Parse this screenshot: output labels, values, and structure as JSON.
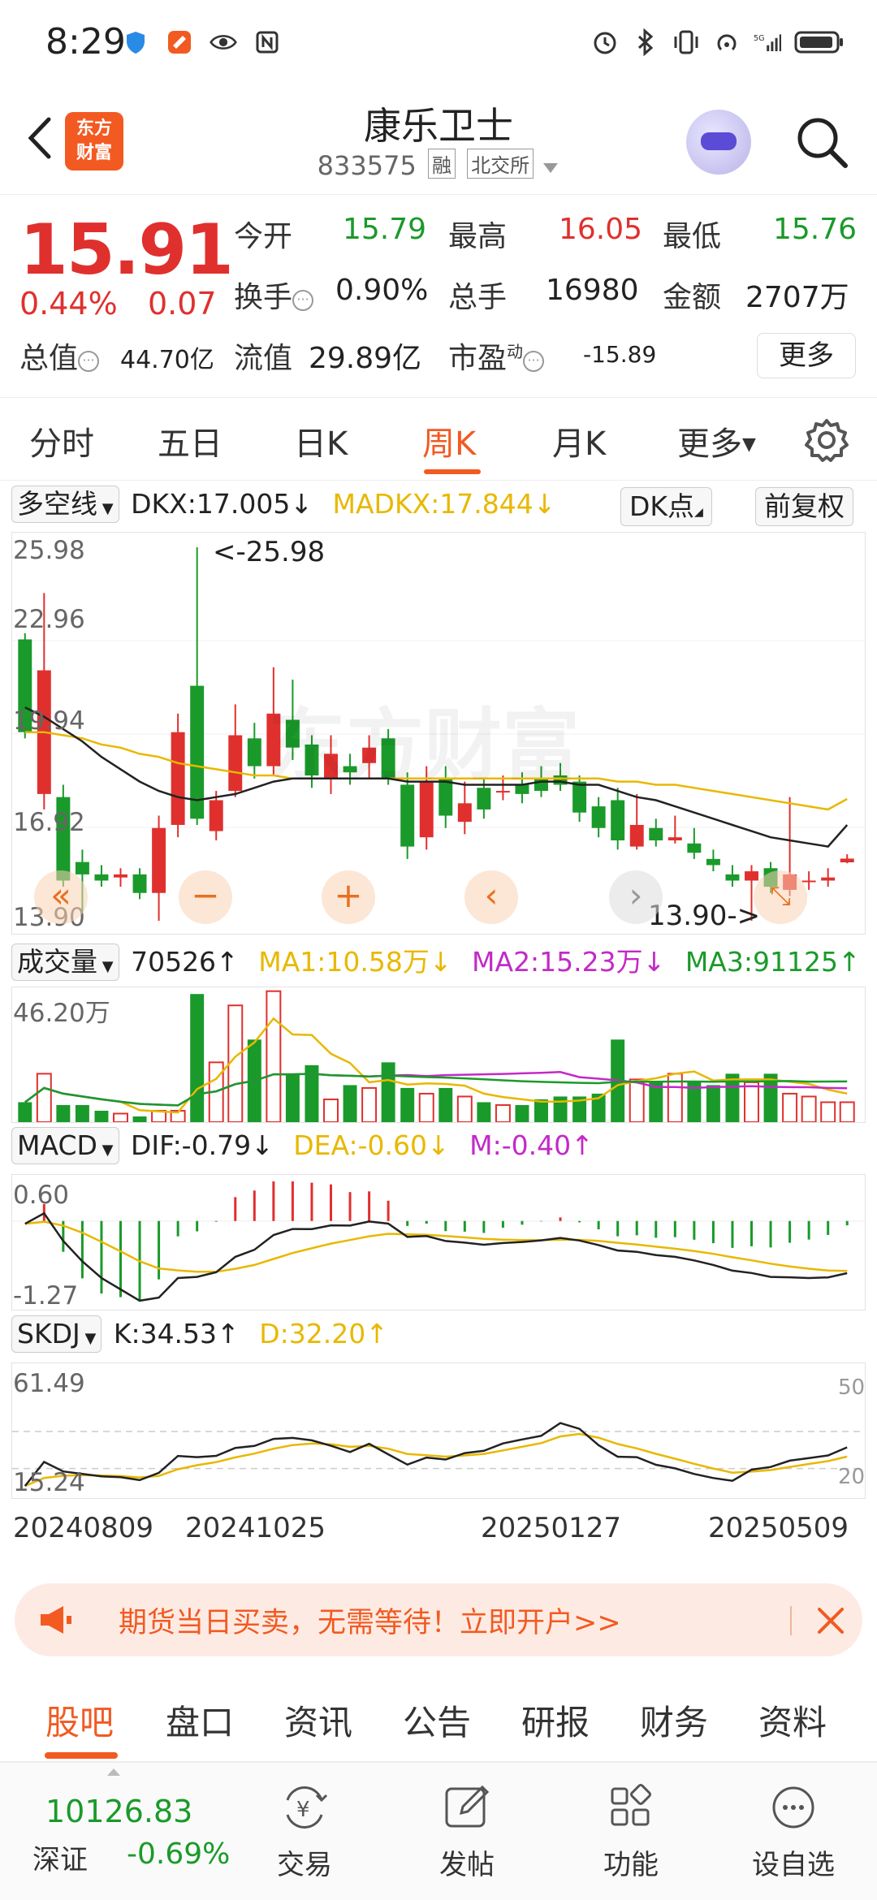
{
  "status_bar": {
    "time": "8:29",
    "left_icons": [
      "shield-icon",
      "message-app-icon",
      "eye-icon",
      "nfc-icon"
    ],
    "right_icons": [
      "alarm-icon",
      "bluetooth-icon",
      "vibrate-icon",
      "hotspot-icon",
      "signal-5g-icon",
      "battery-icon"
    ]
  },
  "header": {
    "logo_line1": "东方",
    "logo_line2": "财富",
    "title": "康乐卫士",
    "code": "833575",
    "tag1": "融",
    "tag2": "北交所"
  },
  "quote": {
    "price": "15.91",
    "change_pct": "0.44%",
    "change_amt": "0.07",
    "open_label": "今开",
    "open": "15.79",
    "high_label": "最高",
    "high": "16.05",
    "low_label": "最低",
    "low": "15.76",
    "turnover_label": "换手",
    "turnover": "0.90%",
    "volume_label": "总手",
    "volume": "16980",
    "amount_label": "金额",
    "amount": "2707万",
    "total_cap_label": "总值",
    "total_cap": "44.70亿",
    "float_cap_label": "流值",
    "float_cap": "29.89亿",
    "pe_label": "市盈",
    "pe_sup": "动",
    "pe": "-15.89",
    "more_label": "更多"
  },
  "period_tabs": {
    "items": [
      "分时",
      "五日",
      "日K",
      "周K",
      "月K",
      "更多"
    ],
    "active": "周K"
  },
  "main_chart": {
    "indicator_select": "多空线",
    "dkx": "DKX:17.005↓",
    "madkx": "MADKX:17.844↓",
    "dk_chip": "DK点",
    "adjust_chip": "前复权",
    "y_labels": [
      "25.98",
      "22.96",
      "19.94",
      "16.92",
      "13.90"
    ],
    "max_annotation": "<-25.98",
    "min_annotation": "13.90->",
    "watermark": "东方财富"
  },
  "volume_chart": {
    "indicator_select": "成交量",
    "vol": "70526↑",
    "ma1": "MA1:10.58万↓",
    "ma2": "MA2:15.23万↓",
    "ma3": "MA3:91125↑",
    "y_label": "46.20万"
  },
  "macd_chart": {
    "indicator_select": "MACD",
    "dif": "DIF:-0.79↓",
    "dea": "DEA:-0.60↓",
    "m": "M:-0.40↑",
    "y_top": "0.60",
    "y_bottom": "-1.27"
  },
  "skdj_chart": {
    "indicator_select": "SKDJ",
    "k": "K:34.53↑",
    "d": "D:32.20↑",
    "y_top": "61.49",
    "y_bottom": "15.24",
    "right_top": "50",
    "right_bottom": "20"
  },
  "dates": [
    "20240809",
    "20241025",
    "20250127",
    "20250509"
  ],
  "colors": {
    "up": "#e0302e",
    "down": "#1a9a2a",
    "accent": "#f25a22",
    "ma_yellow": "#e8b800",
    "ma_magenta": "#c22ac8"
  },
  "banner": {
    "text": "期货当日买卖，无需等待！立即开户>>"
  },
  "bottom_tabs": {
    "items": [
      "股吧",
      "盘口",
      "资讯",
      "公告",
      "研报",
      "财务",
      "资料"
    ],
    "active": "股吧"
  },
  "bottom_nav": {
    "index_value": "10126.83",
    "index_name": "深证",
    "index_pct": "-0.69%",
    "items": [
      "交易",
      "发帖",
      "功能",
      "设自选"
    ]
  },
  "chart_data": {
    "type": "candlestick",
    "period": "weekly",
    "x_tick_labels": [
      "20240809",
      "20241025",
      "20250127",
      "20250509"
    ],
    "price_axis": [
      13.9,
      25.98
    ],
    "price_range_marked": {
      "high": 25.98,
      "low": 13.9
    },
    "candles": [
      {
        "o": 23.0,
        "c": 20.0,
        "h": 23.2,
        "l": 19.8
      },
      {
        "o": 18.0,
        "c": 22.0,
        "h": 24.5,
        "l": 17.5
      },
      {
        "o": 17.9,
        "c": 15.2,
        "h": 18.3,
        "l": 15.0
      },
      {
        "o": 15.8,
        "c": 15.4,
        "h": 16.2,
        "l": 14.2
      },
      {
        "o": 15.4,
        "c": 15.2,
        "h": 15.7,
        "l": 15.0
      },
      {
        "o": 15.3,
        "c": 15.4,
        "h": 15.6,
        "l": 15.0
      },
      {
        "o": 15.4,
        "c": 14.8,
        "h": 15.6,
        "l": 14.6
      },
      {
        "o": 14.8,
        "c": 16.9,
        "h": 17.3,
        "l": 13.9
      },
      {
        "o": 17.0,
        "c": 20.0,
        "h": 20.6,
        "l": 16.6
      },
      {
        "o": 21.5,
        "c": 17.2,
        "h": 25.98,
        "l": 17.0
      },
      {
        "o": 16.8,
        "c": 17.8,
        "h": 18.1,
        "l": 16.5
      },
      {
        "o": 18.1,
        "c": 19.9,
        "h": 20.9,
        "l": 17.9
      },
      {
        "o": 19.8,
        "c": 18.9,
        "h": 20.3,
        "l": 18.5
      },
      {
        "o": 18.9,
        "c": 20.6,
        "h": 22.1,
        "l": 18.6
      },
      {
        "o": 20.4,
        "c": 19.5,
        "h": 21.7,
        "l": 19.1
      },
      {
        "o": 19.6,
        "c": 18.6,
        "h": 19.9,
        "l": 18.2
      },
      {
        "o": 18.5,
        "c": 19.3,
        "h": 19.9,
        "l": 18.0
      },
      {
        "o": 18.9,
        "c": 18.7,
        "h": 19.3,
        "l": 18.3
      },
      {
        "o": 19.0,
        "c": 19.5,
        "h": 19.9,
        "l": 18.5
      },
      {
        "o": 19.8,
        "c": 18.5,
        "h": 20.1,
        "l": 18.3
      },
      {
        "o": 18.3,
        "c": 16.3,
        "h": 18.7,
        "l": 15.9
      },
      {
        "o": 16.6,
        "c": 18.4,
        "h": 18.9,
        "l": 16.2
      },
      {
        "o": 18.5,
        "c": 17.3,
        "h": 18.9,
        "l": 16.9
      },
      {
        "o": 17.1,
        "c": 17.7,
        "h": 18.4,
        "l": 16.7
      },
      {
        "o": 18.2,
        "c": 17.5,
        "h": 18.5,
        "l": 17.2
      },
      {
        "o": 18.1,
        "c": 18.1,
        "h": 18.6,
        "l": 17.8
      },
      {
        "o": 18.3,
        "c": 18.0,
        "h": 18.7,
        "l": 17.7
      },
      {
        "o": 18.5,
        "c": 18.1,
        "h": 18.9,
        "l": 17.9
      },
      {
        "o": 18.6,
        "c": 18.3,
        "h": 19.0,
        "l": 18.1
      },
      {
        "o": 18.4,
        "c": 17.4,
        "h": 18.6,
        "l": 17.1
      },
      {
        "o": 17.6,
        "c": 16.9,
        "h": 17.9,
        "l": 16.6
      },
      {
        "o": 17.8,
        "c": 16.5,
        "h": 18.2,
        "l": 16.2
      },
      {
        "o": 16.3,
        "c": 17.0,
        "h": 18.0,
        "l": 16.2
      },
      {
        "o": 16.9,
        "c": 16.5,
        "h": 17.2,
        "l": 16.3
      },
      {
        "o": 16.5,
        "c": 16.6,
        "h": 17.3,
        "l": 16.4
      },
      {
        "o": 16.4,
        "c": 16.1,
        "h": 16.9,
        "l": 15.9
      },
      {
        "o": 15.9,
        "c": 15.7,
        "h": 16.2,
        "l": 15.5
      },
      {
        "o": 15.4,
        "c": 15.2,
        "h": 15.7,
        "l": 15.0
      },
      {
        "o": 15.2,
        "c": 15.5,
        "h": 15.7,
        "l": 13.9
      },
      {
        "o": 15.6,
        "c": 15.0,
        "h": 15.8,
        "l": 14.8
      },
      {
        "o": 14.9,
        "c": 15.4,
        "h": 17.9,
        "l": 14.7
      },
      {
        "o": 15.2,
        "c": 15.2,
        "h": 15.5,
        "l": 14.9
      },
      {
        "o": 15.2,
        "c": 15.3,
        "h": 15.6,
        "l": 15.0
      },
      {
        "o": 15.79,
        "c": 15.91,
        "h": 16.05,
        "l": 15.76
      }
    ],
    "dkx_line": [
      20.8,
      20.5,
      20.1,
      19.7,
      19.2,
      18.8,
      18.4,
      18.1,
      17.9,
      17.8,
      17.9,
      18.0,
      18.2,
      18.4,
      18.5,
      18.5,
      18.5,
      18.5,
      18.5,
      18.5,
      18.4,
      18.4,
      18.4,
      18.3,
      18.3,
      18.3,
      18.3,
      18.4,
      18.4,
      18.3,
      18.3,
      18.1,
      17.9,
      17.8,
      17.6,
      17.4,
      17.2,
      17.0,
      16.8,
      16.6,
      16.5,
      16.4,
      16.3,
      17.0
    ],
    "madkx_line": [
      20.0,
      20.0,
      19.9,
      19.8,
      19.6,
      19.5,
      19.3,
      19.2,
      19.0,
      18.9,
      18.8,
      18.7,
      18.6,
      18.6,
      18.5,
      18.5,
      18.5,
      18.5,
      18.5,
      18.5,
      18.5,
      18.5,
      18.5,
      18.5,
      18.5,
      18.5,
      18.5,
      18.5,
      18.5,
      18.5,
      18.5,
      18.4,
      18.4,
      18.3,
      18.3,
      18.2,
      18.1,
      18.0,
      17.9,
      17.8,
      17.7,
      17.6,
      17.5,
      17.84
    ],
    "volume_max_label": "46.20万",
    "volumes_wan": [
      7,
      17,
      6,
      6,
      4,
      3,
      2,
      4,
      4,
      45,
      21,
      41,
      29,
      46,
      17,
      20,
      8,
      13,
      12,
      21,
      12,
      10,
      12,
      9,
      7,
      6,
      6,
      8,
      9,
      9,
      10,
      29,
      15,
      14,
      17,
      14,
      13,
      17,
      14,
      17,
      10,
      9,
      7,
      7
    ],
    "macd_range": [
      -1.27,
      0.6
    ],
    "skdj_range": [
      15.24,
      61.49
    ],
    "latest": {
      "DKX": 17.005,
      "MADKX": 17.844,
      "VOL": 70526,
      "MA1": "10.58万",
      "MA2": "15.23万",
      "MA3": 91125,
      "DIF": -0.79,
      "DEA": -0.6,
      "M": -0.4,
      "K": 34.53,
      "D": 32.2
    }
  }
}
